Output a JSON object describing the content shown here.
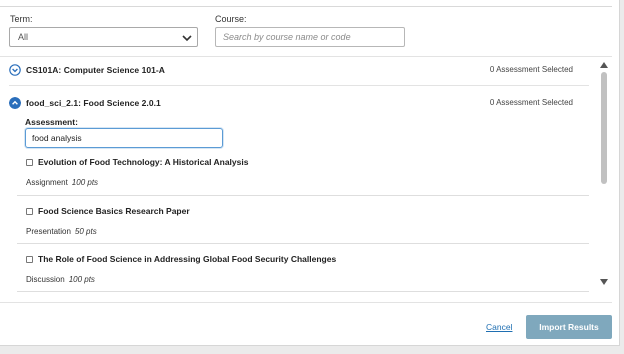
{
  "filters": {
    "term_label": "Term:",
    "term_value": "All",
    "course_label": "Course:",
    "course_placeholder": "Search by course name or code"
  },
  "courses": [
    {
      "name": "CS101A: Computer Science 101-A",
      "selected_count": "0 Assessment Selected",
      "expanded": false
    },
    {
      "name": "food_sci_2.1: Food Science 2.0.1",
      "selected_count": "0 Assessment Selected",
      "expanded": true
    }
  ],
  "assessment": {
    "label": "Assessment:",
    "search_value": "food analysis"
  },
  "items": [
    {
      "title": "Evolution of Food Technology: A Historical Analysis",
      "type": "Assignment",
      "points": "100 pts",
      "checked": false
    },
    {
      "title": "Food Science Basics Research Paper",
      "type": "Presentation",
      "points": "50 pts",
      "checked": false
    },
    {
      "title": "The Role of Food Science in Addressing Global Food Security Challenges",
      "type": "Discussion",
      "points": "100 pts",
      "checked": false
    }
  ],
  "footer": {
    "cancel_label": "Cancel",
    "import_label": "Import Results"
  },
  "colors": {
    "accent_blue": "#1f6fb2",
    "import_button": "#7fa8bd",
    "toggle_blue": "#2a6ebb"
  },
  "icons": {
    "term_dropdown": "chevron-down-icon",
    "collapsed_course": "expand-circle-icon",
    "expanded_course": "collapse-circle-icon"
  }
}
